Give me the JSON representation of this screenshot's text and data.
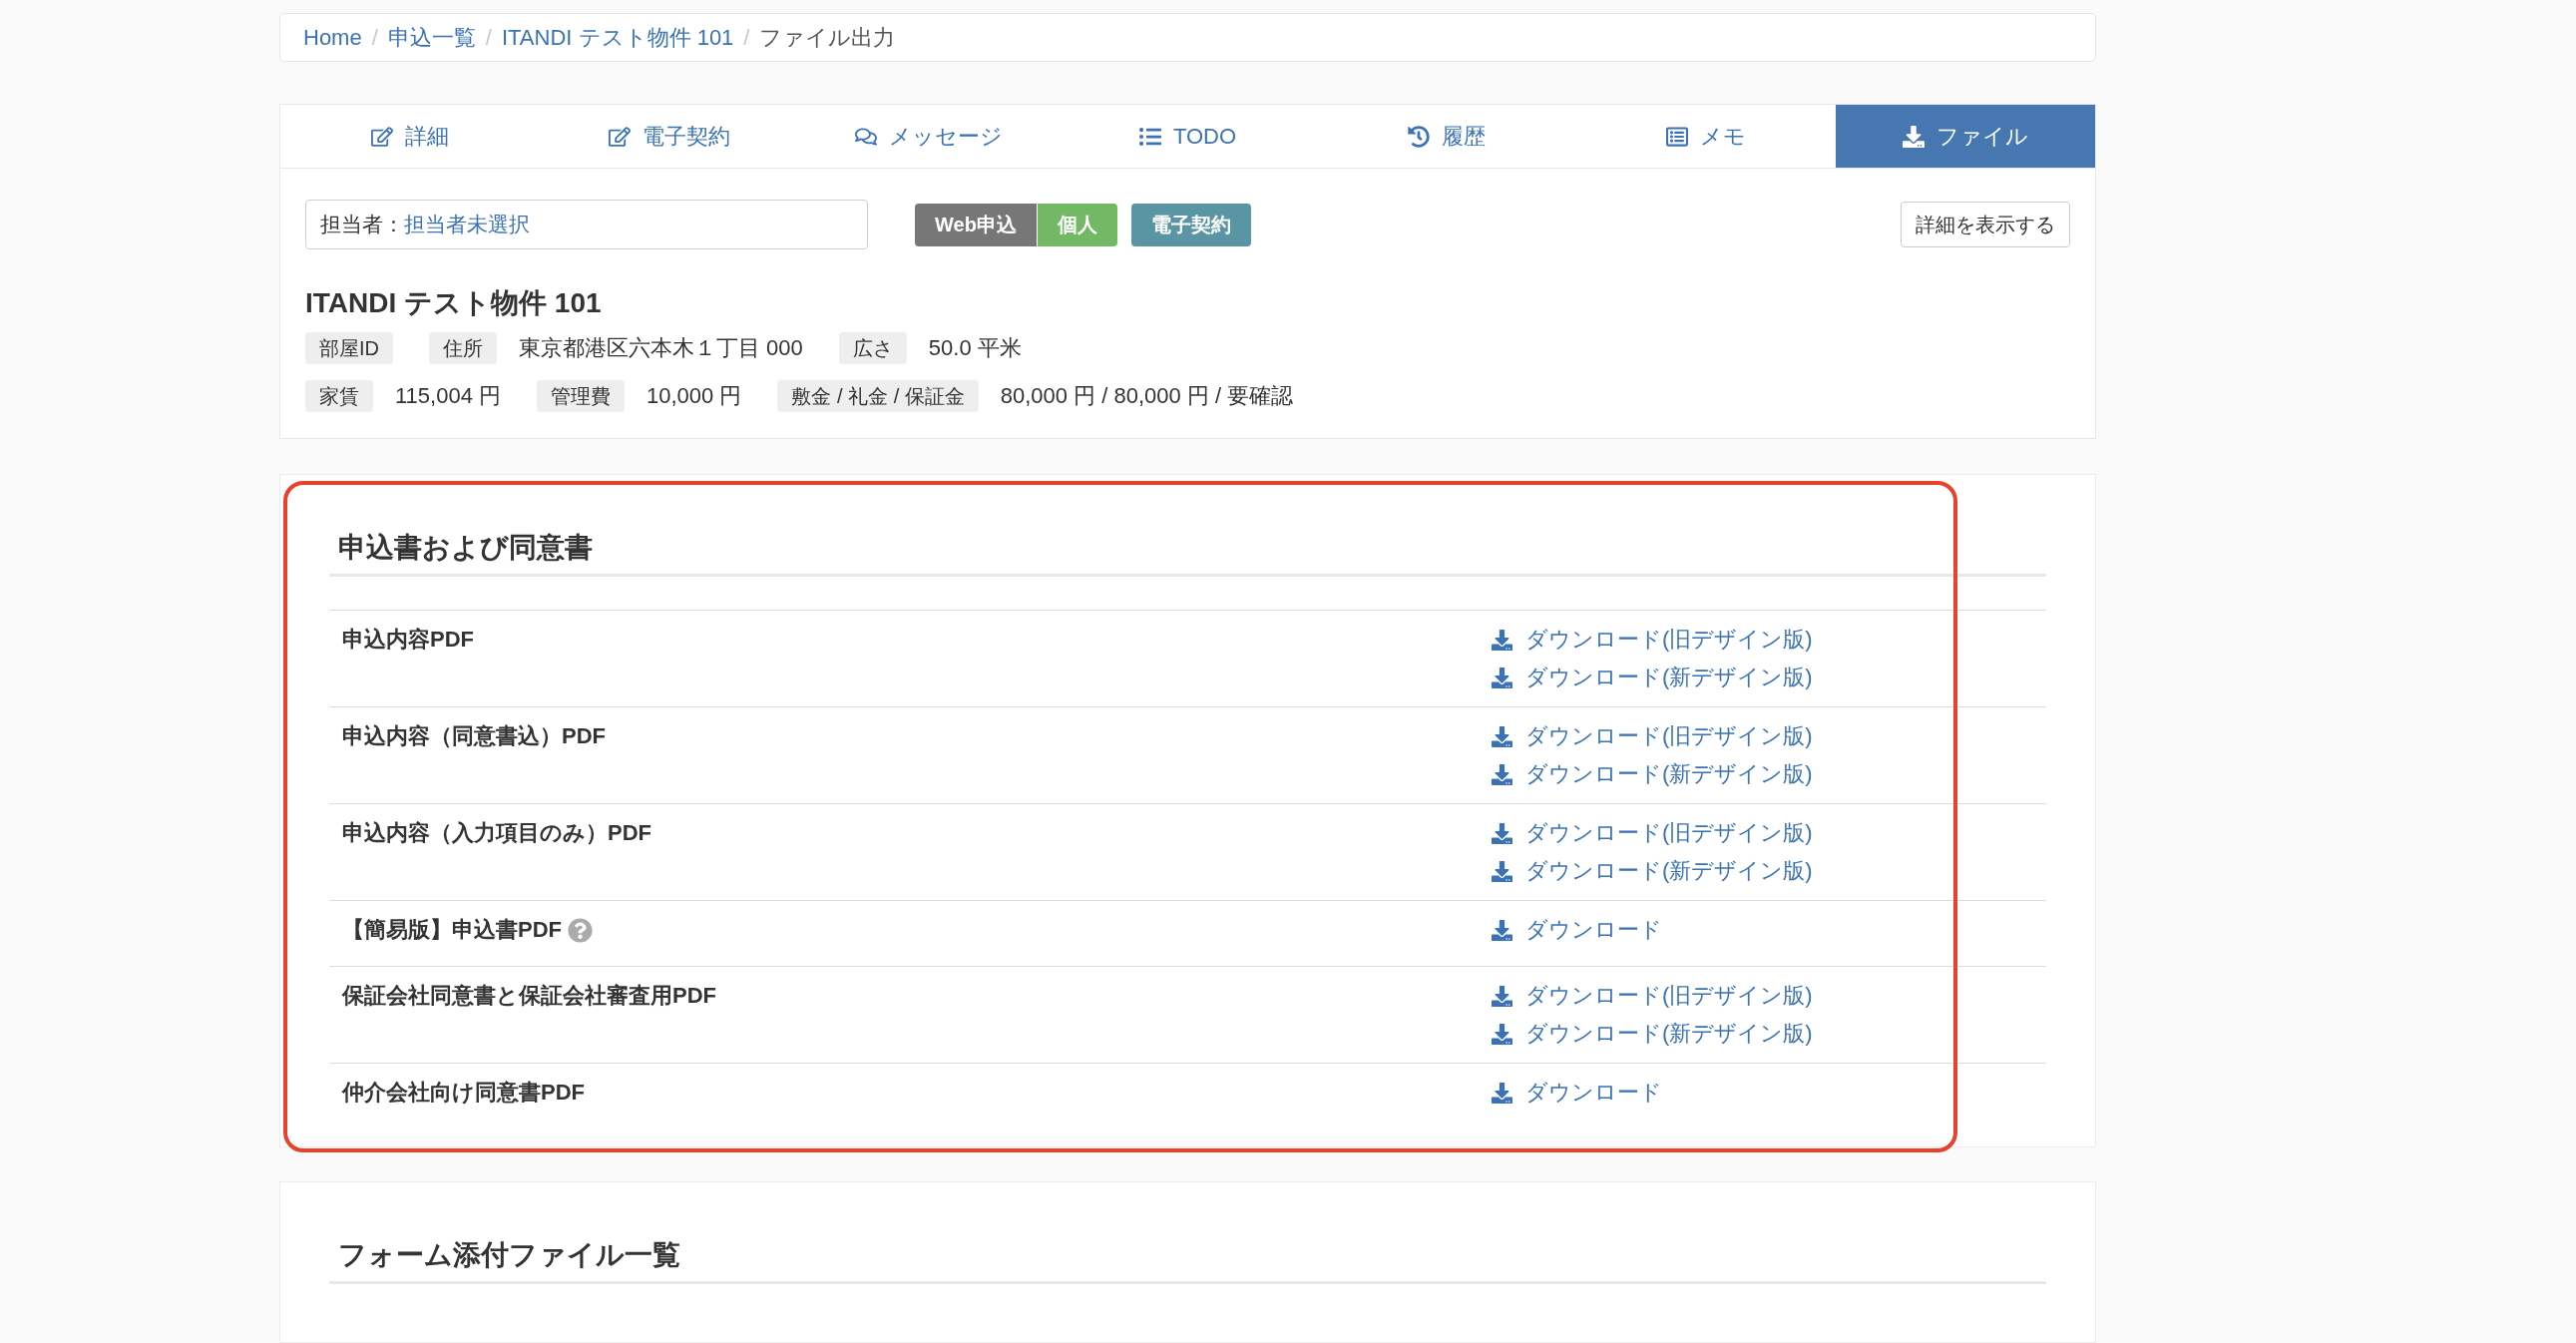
{
  "breadcrumb": {
    "separator": "/",
    "items": [
      {
        "label": "Home",
        "current": false
      },
      {
        "label": "申込一覧",
        "current": false
      },
      {
        "label": "ITANDI テスト物件 101",
        "current": false
      },
      {
        "label": "ファイル出力",
        "current": true
      }
    ]
  },
  "tabs": [
    {
      "label": "詳細",
      "selected": false
    },
    {
      "label": "電子契約",
      "selected": false
    },
    {
      "label": "メッセージ",
      "selected": false
    },
    {
      "label": "TODO",
      "selected": false
    },
    {
      "label": "履歴",
      "selected": false
    },
    {
      "label": "メモ",
      "selected": false
    },
    {
      "label": "ファイル",
      "selected": true
    }
  ],
  "assignee": {
    "label": "担当者：",
    "value": "担当者未選択"
  },
  "badge_groups": [
    {
      "badges": [
        {
          "label": "Web申込",
          "color": "#777777"
        },
        {
          "label": "個人",
          "color": "#72b865"
        }
      ]
    },
    {
      "badges": [
        {
          "label": "電子契約",
          "color": "#5a95a3"
        }
      ]
    }
  ],
  "details_button": "詳細を表示する",
  "property": {
    "title": "ITANDI テスト物件 101",
    "field_rows": [
      {
        "fields": [
          {
            "label": "部屋ID"
          },
          {
            "label": "住所",
            "value": "東京都港区六本木１丁目 000"
          },
          {
            "label": "広さ",
            "value": "50.0 平米"
          }
        ]
      },
      {
        "fields": [
          {
            "label": "家賃",
            "value": "115,004 円"
          },
          {
            "label": "管理費",
            "value": "10,000 円"
          },
          {
            "label": "敷金 / 礼金 / 保証金",
            "value": "80,000 円 / 80,000 円 / 要確認"
          }
        ]
      }
    ]
  },
  "sections": [
    {
      "title": "申込書および同意書",
      "highlighted": true,
      "rows": [
        {
          "label": "申込内容PDF",
          "help": false,
          "links": [
            "ダウンロード(旧デザイン版)",
            "ダウンロード(新デザイン版)"
          ]
        },
        {
          "label": "申込内容（同意書込）PDF",
          "help": false,
          "links": [
            "ダウンロード(旧デザイン版)",
            "ダウンロード(新デザイン版)"
          ]
        },
        {
          "label": "申込内容（入力項目のみ）PDF",
          "help": false,
          "links": [
            "ダウンロード(旧デザイン版)",
            "ダウンロード(新デザイン版)"
          ]
        },
        {
          "label": "【簡易版】申込書PDF",
          "help": true,
          "links": [
            "ダウンロード"
          ]
        },
        {
          "label": "保証会社同意書と保証会社審査用PDF",
          "help": false,
          "links": [
            "ダウンロード(旧デザイン版)",
            "ダウンロード(新デザイン版)"
          ]
        },
        {
          "label": "仲介会社向け同意書PDF",
          "help": false,
          "links": [
            "ダウンロード"
          ]
        }
      ]
    },
    {
      "title": "フォーム添付ファイル一覧",
      "highlighted": false
    }
  ]
}
